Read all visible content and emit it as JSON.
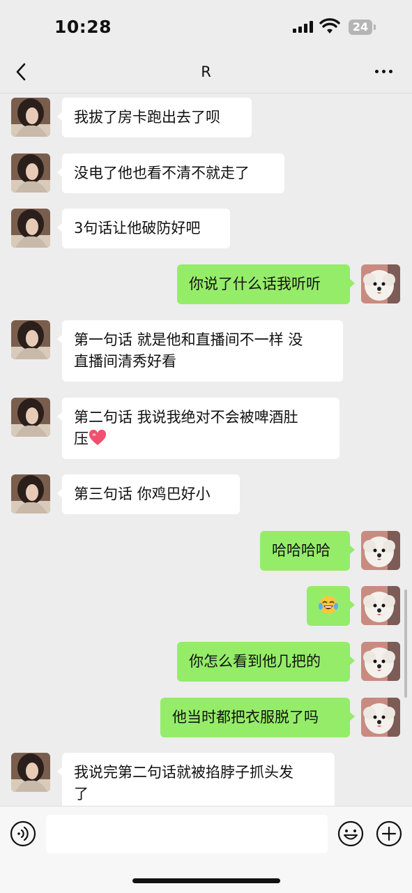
{
  "status_bar": {
    "time": "10:28",
    "battery": "24"
  },
  "header": {
    "title": "R"
  },
  "messages": [
    {
      "side": "left",
      "lines": [
        "我拔了房卡跑出去了呗"
      ]
    },
    {
      "side": "left",
      "lines": [
        "没电了他也看不清不就走了"
      ]
    },
    {
      "side": "left",
      "lines": [
        "3句话让他破防好吧"
      ]
    },
    {
      "side": "right",
      "lines": [
        "你说了什么话我听听"
      ]
    },
    {
      "side": "left",
      "lines": [
        "第一句话 就是他和直播间不一样 没",
        "直播间清秀好看"
      ]
    },
    {
      "side": "left",
      "lines": [
        "第二句话 我说我绝对不会被啤酒肚",
        "压"
      ],
      "trailing_icon": "heart-emoji"
    },
    {
      "side": "left",
      "lines": [
        "第三句话 你鸡巴好小"
      ]
    },
    {
      "side": "right",
      "lines": [
        "哈哈哈哈"
      ]
    },
    {
      "side": "right",
      "lines": [],
      "emoji": "tears-of-joy-emoji"
    },
    {
      "side": "right",
      "lines": [
        "你怎么看到他几把的"
      ]
    },
    {
      "side": "right",
      "lines": [
        "他当时都把衣服脱了吗"
      ]
    },
    {
      "side": "left",
      "lines": [
        "我说完第二句话就被掐脖子抓头发",
        "了"
      ]
    }
  ],
  "input_bar": {
    "value": "",
    "placeholder": ""
  },
  "colors": {
    "background": "#ededed",
    "bubble_self": "#95ec69",
    "bubble_other": "#ffffff"
  },
  "icons": [
    "back-icon",
    "more-icon",
    "voice-icon",
    "emoji-icon",
    "plus-icon"
  ]
}
